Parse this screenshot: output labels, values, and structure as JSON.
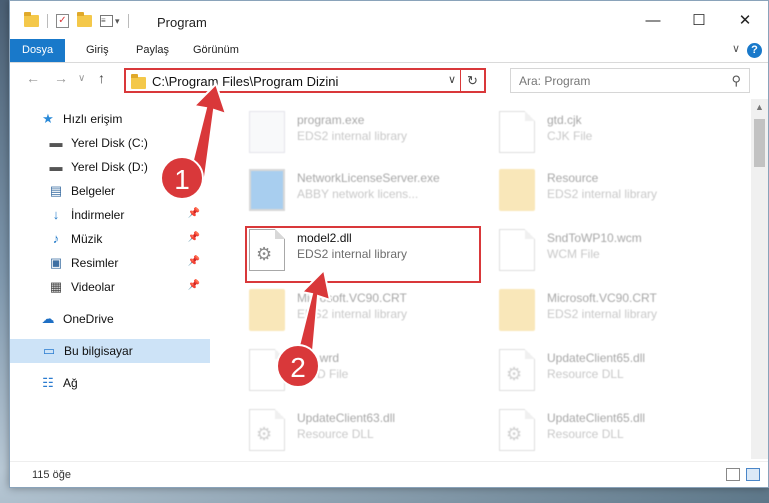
{
  "window": {
    "title": "Program",
    "minimize": "—",
    "maximize": "☐",
    "close": "✕"
  },
  "ribbon": {
    "tabs": [
      {
        "label": "Dosya",
        "active": true
      },
      {
        "label": "Giriş"
      },
      {
        "label": "Paylaş"
      },
      {
        "label": "Görünüm"
      }
    ],
    "collapse": "∨",
    "help": "?"
  },
  "address": {
    "path": "C:\\Program Files\\Program Dizini",
    "dropdown": "∨",
    "refresh": "↻"
  },
  "nav": {
    "back": "←",
    "forward": "→",
    "recent": "∨",
    "up": "↑"
  },
  "search": {
    "placeholder": "Ara: Program",
    "icon": "search-icon"
  },
  "sidebar": {
    "items": [
      {
        "label": "Hızlı erişim",
        "icon": "star-icon",
        "glyph": "★"
      },
      {
        "label": "Yerel Disk (C:)",
        "icon": "drive-icon",
        "glyph": "▬",
        "pinned": true
      },
      {
        "label": "Yerel Disk (D:)",
        "icon": "drive-icon",
        "glyph": "▬",
        "pinned": true
      },
      {
        "label": "Belgeler",
        "icon": "documents-icon",
        "glyph": "▤",
        "pinned": true
      },
      {
        "label": "İndirmeler",
        "icon": "download-icon",
        "glyph": "↓",
        "pinned": true
      },
      {
        "label": "Müzik",
        "icon": "music-icon",
        "glyph": "♪",
        "pinned": true
      },
      {
        "label": "Resimler",
        "icon": "pictures-icon",
        "glyph": "▣",
        "pinned": true
      },
      {
        "label": "Videolar",
        "icon": "videos-icon",
        "glyph": "▦",
        "pinned": true
      },
      {
        "label": "OneDrive",
        "icon": "cloud-icon",
        "glyph": "☁"
      },
      {
        "label": "Bu bilgisayar",
        "icon": "computer-icon",
        "glyph": "▭",
        "selected": true
      },
      {
        "label": "Ağ",
        "icon": "network-icon",
        "glyph": "☷"
      }
    ]
  },
  "files": [
    {
      "name": "program.exe",
      "desc": "EDS2 internal library",
      "faded": true
    },
    {
      "name": "gtd.cjk",
      "desc": "CJK File",
      "faded": true
    },
    {
      "name": "NetworkLicenseServer.exe",
      "desc": "ABBY network licens...",
      "faded": true
    },
    {
      "name": "Resource",
      "desc": "EDS2 internal library",
      "faded": true
    },
    {
      "name": "model2.dll",
      "desc": "EDS2 internal library",
      "faded": false
    },
    {
      "name": "SndToWP10.wcm",
      "desc": "WCM File",
      "faded": true
    },
    {
      "name": "Microsoft.VC90.CRT",
      "desc": "EDS2 internal library",
      "faded": true
    },
    {
      "name": "Microsoft.VC90.CRT",
      "desc": "EDS2 internal library",
      "faded": true
    },
    {
      "name": "test.wrd",
      "desc": "WRD File",
      "faded": true
    },
    {
      "name": "UpdateClient65.dll",
      "desc": "Resource DLL",
      "faded": true
    },
    {
      "name": "UpdateClient63.dll",
      "desc": "Resource DLL",
      "faded": true
    },
    {
      "name": "UpdateClient65.dll",
      "desc": "Resource DLL",
      "faded": true
    }
  ],
  "status": {
    "count": "115 öğe"
  },
  "annotations": {
    "step1": "1",
    "step2": "2",
    "color": "#d9383a"
  },
  "colors": {
    "accent": "#1979ca",
    "selected": "#cde3f7"
  }
}
